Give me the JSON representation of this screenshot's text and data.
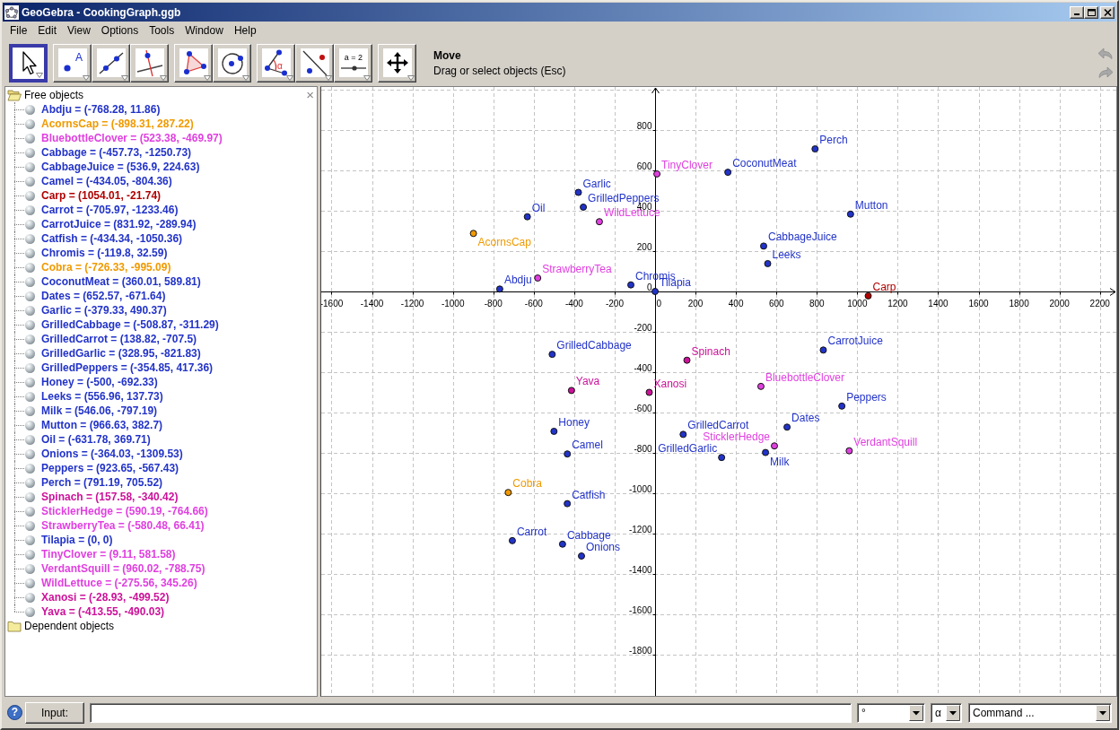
{
  "window": {
    "title": "GeoGebra - CookingGraph.ggb"
  },
  "menu": [
    {
      "label": "File"
    },
    {
      "label": "Edit"
    },
    {
      "label": "View"
    },
    {
      "label": "Options"
    },
    {
      "label": "Tools"
    },
    {
      "label": "Window"
    },
    {
      "label": "Help"
    }
  ],
  "toolbar": {
    "groups": [
      {
        "tools": [
          {
            "kind": "move",
            "selected": true
          }
        ]
      },
      {
        "tools": [
          {
            "kind": "point",
            "icon_text": "A",
            "selected": false
          },
          {
            "kind": "line",
            "selected": false
          },
          {
            "kind": "perpendicular",
            "selected": false
          }
        ]
      },
      {
        "tools": [
          {
            "kind": "polygon",
            "selected": false
          },
          {
            "kind": "circle",
            "selected": false
          }
        ]
      },
      {
        "tools": [
          {
            "kind": "angle",
            "icon_text": "α",
            "selected": false
          },
          {
            "kind": "reflect",
            "selected": false
          },
          {
            "kind": "slider",
            "icon_text": "a = 2",
            "selected": false
          }
        ]
      },
      {
        "tools": [
          {
            "kind": "move-view",
            "selected": false
          }
        ]
      }
    ],
    "tool_name": "Move",
    "tool_help": "Drag or select objects (Esc)"
  },
  "algebra": {
    "close_glyph": "×",
    "folders": [
      {
        "label": "Free objects",
        "expanded": true,
        "children": [
          {
            "label": "Abdju = (-768.28, 11.86)",
            "color": "#2233c8"
          },
          {
            "label": "AcornsCap = (-898.31, 287.22)",
            "color": "#f09a00"
          },
          {
            "label": "BluebottleClover = (523.38, -469.97)",
            "color": "#e040e0"
          },
          {
            "label": "Cabbage = (-457.73, -1250.73)",
            "color": "#2233c8"
          },
          {
            "label": "CabbageJuice = (536.9, 224.63)",
            "color": "#2233c8"
          },
          {
            "label": "Camel = (-434.05, -804.36)",
            "color": "#2233c8"
          },
          {
            "label": "Carp = (1054.01, -21.74)",
            "color": "#b00000"
          },
          {
            "label": "Carrot = (-705.97, -1233.46)",
            "color": "#2233c8"
          },
          {
            "label": "CarrotJuice = (831.92, -289.94)",
            "color": "#2233c8"
          },
          {
            "label": "Catfish = (-434.34, -1050.36)",
            "color": "#2233c8"
          },
          {
            "label": "Chromis = (-119.8, 32.59)",
            "color": "#2233c8"
          },
          {
            "label": "Cobra = (-726.33, -995.09)",
            "color": "#f09a00"
          },
          {
            "label": "CoconutMeat = (360.01, 589.81)",
            "color": "#2233c8"
          },
          {
            "label": "Dates = (652.57, -671.64)",
            "color": "#2233c8"
          },
          {
            "label": "Garlic = (-379.33, 490.37)",
            "color": "#2233c8"
          },
          {
            "label": "GrilledCabbage = (-508.87, -311.29)",
            "color": "#2233c8"
          },
          {
            "label": "GrilledCarrot = (138.82, -707.5)",
            "color": "#2233c8"
          },
          {
            "label": "GrilledGarlic = (328.95, -821.83)",
            "color": "#2233c8"
          },
          {
            "label": "GrilledPeppers = (-354.85, 417.36)",
            "color": "#2233c8"
          },
          {
            "label": "Honey = (-500, -692.33)",
            "color": "#2233c8"
          },
          {
            "label": "Leeks = (556.96, 137.73)",
            "color": "#2233c8"
          },
          {
            "label": "Milk = (546.06, -797.19)",
            "color": "#2233c8"
          },
          {
            "label": "Mutton = (966.63, 382.7)",
            "color": "#2233c8"
          },
          {
            "label": "Oil = (-631.78, 369.71)",
            "color": "#2233c8"
          },
          {
            "label": "Onions = (-364.03, -1309.53)",
            "color": "#2233c8"
          },
          {
            "label": "Peppers = (923.65, -567.43)",
            "color": "#2233c8"
          },
          {
            "label": "Perch = (791.19, 705.52)",
            "color": "#2233c8"
          },
          {
            "label": "Spinach = (157.58, -340.42)",
            "color": "#cc1199"
          },
          {
            "label": "SticklerHedge = (590.19, -764.66)",
            "color": "#e040e0"
          },
          {
            "label": "StrawberryTea = (-580.48, 66.41)",
            "color": "#e040e0"
          },
          {
            "label": "Tilapia = (0, 0)",
            "color": "#2233c8"
          },
          {
            "label": "TinyClover = (9.11, 581.58)",
            "color": "#e040e0"
          },
          {
            "label": "VerdantSquill = (960.02, -788.75)",
            "color": "#e040e0"
          },
          {
            "label": "WildLettuce = (-275.56, 345.26)",
            "color": "#e040e0"
          },
          {
            "label": "Xanosi = (-28.93, -499.52)",
            "color": "#cc1199"
          },
          {
            "label": "Yava = (-413.55, -490.03)",
            "color": "#cc1199"
          }
        ]
      },
      {
        "label": "Dependent objects",
        "expanded": false
      }
    ]
  },
  "graph": {
    "chart_data": {
      "type": "scatter",
      "grid": true,
      "xlim": [
        -1651,
        2281
      ],
      "ylim": [
        -2002,
        1012
      ],
      "xticks": [
        -1600,
        -1400,
        -1200,
        -1000,
        -800,
        -600,
        -400,
        -200,
        0,
        200,
        400,
        600,
        800,
        1000,
        1200,
        1400,
        1600,
        1800,
        2000,
        2200
      ],
      "yticks": [
        -1800,
        -1600,
        -1400,
        -1200,
        -1000,
        -800,
        -600,
        -400,
        -200,
        0,
        200,
        400,
        600,
        800
      ],
      "series": [
        {
          "name": "Abdju",
          "color": "#2233c8",
          "x": [
            -768.28
          ],
          "values": [
            11.86
          ]
        },
        {
          "name": "AcornsCap",
          "color": "#f09a00",
          "x": [
            -898.31
          ],
          "values": [
            287.22
          ]
        },
        {
          "name": "BluebottleClover",
          "color": "#e040e0",
          "x": [
            523.38
          ],
          "values": [
            -469.97
          ]
        },
        {
          "name": "Cabbage",
          "color": "#2233c8",
          "x": [
            -457.73
          ],
          "values": [
            -1250.73
          ]
        },
        {
          "name": "CabbageJuice",
          "color": "#2233c8",
          "x": [
            536.9
          ],
          "values": [
            224.63
          ]
        },
        {
          "name": "Camel",
          "color": "#2233c8",
          "x": [
            -434.05
          ],
          "values": [
            -804.36
          ]
        },
        {
          "name": "Carp",
          "color": "#b00000",
          "x": [
            1054.01
          ],
          "values": [
            -21.74
          ]
        },
        {
          "name": "Carrot",
          "color": "#2233c8",
          "x": [
            -705.97
          ],
          "values": [
            -1233.46
          ]
        },
        {
          "name": "CarrotJuice",
          "color": "#2233c8",
          "x": [
            831.92
          ],
          "values": [
            -289.94
          ]
        },
        {
          "name": "Catfish",
          "color": "#2233c8",
          "x": [
            -434.34
          ],
          "values": [
            -1050.36
          ]
        },
        {
          "name": "Chromis",
          "color": "#2233c8",
          "x": [
            -119.8
          ],
          "values": [
            32.59
          ]
        },
        {
          "name": "Cobra",
          "color": "#f09a00",
          "x": [
            -726.33
          ],
          "values": [
            -995.09
          ]
        },
        {
          "name": "CoconutMeat",
          "color": "#2233c8",
          "x": [
            360.01
          ],
          "values": [
            589.81
          ]
        },
        {
          "name": "Dates",
          "color": "#2233c8",
          "x": [
            652.57
          ],
          "values": [
            -671.64
          ]
        },
        {
          "name": "Garlic",
          "color": "#2233c8",
          "x": [
            -379.33
          ],
          "values": [
            490.37
          ]
        },
        {
          "name": "GrilledCabbage",
          "color": "#2233c8",
          "x": [
            -508.87
          ],
          "values": [
            -311.29
          ]
        },
        {
          "name": "GrilledCarrot",
          "color": "#2233c8",
          "x": [
            138.82
          ],
          "values": [
            -707.5
          ]
        },
        {
          "name": "GrilledGarlic",
          "color": "#2233c8",
          "x": [
            328.95
          ],
          "values": [
            -821.83
          ]
        },
        {
          "name": "GrilledPeppers",
          "color": "#2233c8",
          "x": [
            -354.85
          ],
          "values": [
            417.36
          ]
        },
        {
          "name": "Honey",
          "color": "#2233c8",
          "x": [
            -500
          ],
          "values": [
            -692.33
          ]
        },
        {
          "name": "Leeks",
          "color": "#2233c8",
          "x": [
            556.96
          ],
          "values": [
            137.73
          ]
        },
        {
          "name": "Milk",
          "color": "#2233c8",
          "x": [
            546.06
          ],
          "values": [
            -797.19
          ]
        },
        {
          "name": "Mutton",
          "color": "#2233c8",
          "x": [
            966.63
          ],
          "values": [
            382.7
          ]
        },
        {
          "name": "Oil",
          "color": "#2233c8",
          "x": [
            -631.78
          ],
          "values": [
            369.71
          ]
        },
        {
          "name": "Onions",
          "color": "#2233c8",
          "x": [
            -364.03
          ],
          "values": [
            -1309.53
          ]
        },
        {
          "name": "Peppers",
          "color": "#2233c8",
          "x": [
            923.65
          ],
          "values": [
            -567.43
          ]
        },
        {
          "name": "Perch",
          "color": "#2233c8",
          "x": [
            791.19
          ],
          "values": [
            705.52
          ]
        },
        {
          "name": "Spinach",
          "color": "#cc1199",
          "x": [
            157.58
          ],
          "values": [
            -340.42
          ]
        },
        {
          "name": "SticklerHedge",
          "color": "#e040e0",
          "x": [
            590.19
          ],
          "values": [
            -764.66
          ]
        },
        {
          "name": "StrawberryTea",
          "color": "#e040e0",
          "x": [
            -580.48
          ],
          "values": [
            66.41
          ]
        },
        {
          "name": "Tilapia",
          "color": "#2233c8",
          "x": [
            0
          ],
          "values": [
            0
          ]
        },
        {
          "name": "TinyClover",
          "color": "#e040e0",
          "x": [
            9.11
          ],
          "values": [
            581.58
          ]
        },
        {
          "name": "VerdantSquill",
          "color": "#e040e0",
          "x": [
            960.02
          ],
          "values": [
            -788.75
          ]
        },
        {
          "name": "WildLettuce",
          "color": "#e040e0",
          "x": [
            -275.56
          ],
          "values": [
            345.26
          ]
        },
        {
          "name": "Xanosi",
          "color": "#cc1199",
          "x": [
            -28.93
          ],
          "values": [
            -499.52
          ]
        },
        {
          "name": "Yava",
          "color": "#cc1199",
          "x": [
            -413.55
          ],
          "values": [
            -490.03
          ]
        }
      ]
    }
  },
  "input_bar": {
    "help_glyph": "?",
    "button": "Input:",
    "unit": "°",
    "symbol": "α",
    "command": "Command ..."
  }
}
